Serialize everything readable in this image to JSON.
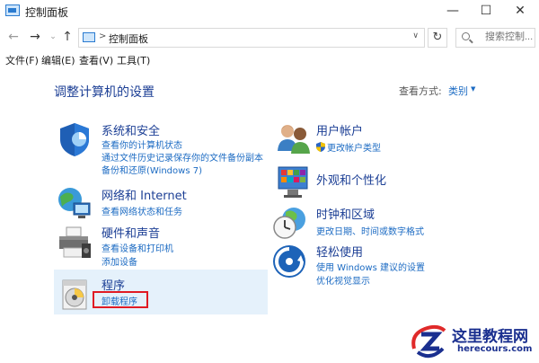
{
  "window": {
    "title": "控制面板",
    "minimize_glyph": "—",
    "maximize_glyph": "☐",
    "close_glyph": "✕"
  },
  "address": {
    "back_glyph": "←",
    "forward_glyph": "→",
    "history_glyph": "⌄",
    "up_glyph": "↑",
    "separator": ">",
    "path": "控制面板",
    "dropdown_glyph": "∨",
    "refresh_glyph": "↻",
    "search_placeholder": "搜索控制..."
  },
  "menu": [
    "文件(F)",
    "编辑(E)",
    "查看(V)",
    "工具(T)"
  ],
  "content": {
    "heading": "调整计算机的设置",
    "view_by_label": "查看方式:",
    "view_by_value": "类别",
    "view_by_caret": "▼"
  },
  "categories": {
    "system": {
      "title": "系统和安全",
      "icon": "shield-icon",
      "links": [
        "查看你的计算机状态",
        "通过文件历史记录保存你的文件备份副本",
        "备份和还原(Windows 7)"
      ]
    },
    "network": {
      "title": "网络和 Internet",
      "icon": "network-globe-icon",
      "links": [
        "查看网络状态和任务"
      ]
    },
    "hardware": {
      "title": "硬件和声音",
      "icon": "printer-icon",
      "links": [
        "查看设备和打印机",
        "添加设备"
      ]
    },
    "programs": {
      "title": "程序",
      "icon": "programs-disc-icon",
      "links": [
        "卸载程序"
      ]
    },
    "users": {
      "title": "用户帐户",
      "icon": "users-icon",
      "links": [
        "更改帐户类型"
      ]
    },
    "appearance": {
      "title": "外观和个性化",
      "icon": "appearance-palette-icon",
      "links": []
    },
    "clock": {
      "title": "时钟和区域",
      "icon": "clock-globe-icon",
      "links": [
        "更改日期、时间或数字格式"
      ]
    },
    "ease": {
      "title": "轻松使用",
      "icon": "ease-of-access-icon",
      "links": [
        "使用 Windows 建议的设置",
        "优化视觉显示"
      ]
    }
  },
  "watermark": {
    "line1": "这里教程网",
    "line2": "herecours.com"
  },
  "colors": {
    "heading": "#1c3f95",
    "link": "#1c6bc3",
    "highlight": "#e5f1fb",
    "annotation_box": "#e01b24"
  }
}
